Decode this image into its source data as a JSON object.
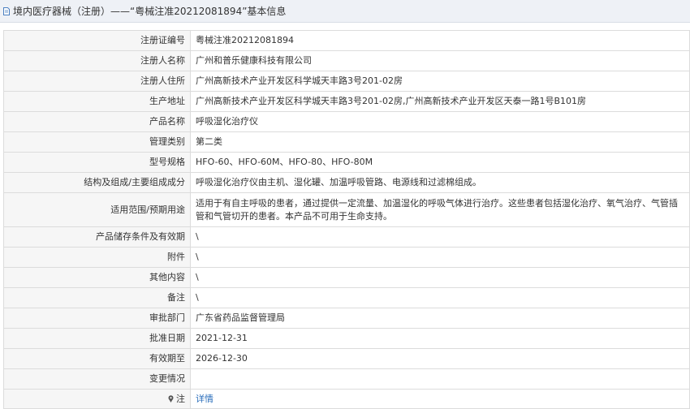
{
  "header": {
    "title": "境内医疗器械（注册）——“粤械注准20212081894”基本信息",
    "icon": "document-icon"
  },
  "rows": [
    {
      "label": "注册证编号",
      "value": "粤械注准20212081894"
    },
    {
      "label": "注册人名称",
      "value": "广州和普乐健康科技有限公司"
    },
    {
      "label": "注册人住所",
      "value": "广州高新技术产业开发区科学城天丰路3号201-02房"
    },
    {
      "label": "生产地址",
      "value": "广州高新技术产业开发区科学城天丰路3号201-02房,广州高新技术产业开发区天泰一路1号B101房"
    },
    {
      "label": "产品名称",
      "value": "呼吸湿化治疗仪"
    },
    {
      "label": "管理类别",
      "value": "第二类"
    },
    {
      "label": "型号规格",
      "value": "HFO-60、HFO-60M、HFO-80、HFO-80M"
    },
    {
      "label": "结构及组成/主要组成成分",
      "value": "呼吸湿化治疗仪由主机、湿化罐、加温呼吸管路、电源线和过滤棉组成。"
    },
    {
      "label": "适用范围/预期用途",
      "value": "适用于有自主呼吸的患者，通过提供一定流量、加温湿化的呼吸气体进行治疗。这些患者包括湿化治疗、氧气治疗、气管插管和气管切开的患者。本产品不可用于生命支持。"
    },
    {
      "label": "产品储存条件及有效期",
      "value": "\\"
    },
    {
      "label": "附件",
      "value": "\\"
    },
    {
      "label": "其他内容",
      "value": "\\"
    },
    {
      "label": "备注",
      "value": "\\"
    },
    {
      "label": "审批部门",
      "value": "广东省药品监督管理局"
    },
    {
      "label": "批准日期",
      "value": "2021-12-31"
    },
    {
      "label": "有效期至",
      "value": "2026-12-30"
    },
    {
      "label": "变更情况",
      "value": ""
    }
  ],
  "footer_row": {
    "label": "注",
    "label_icon": "pin-icon",
    "link": "详情"
  }
}
